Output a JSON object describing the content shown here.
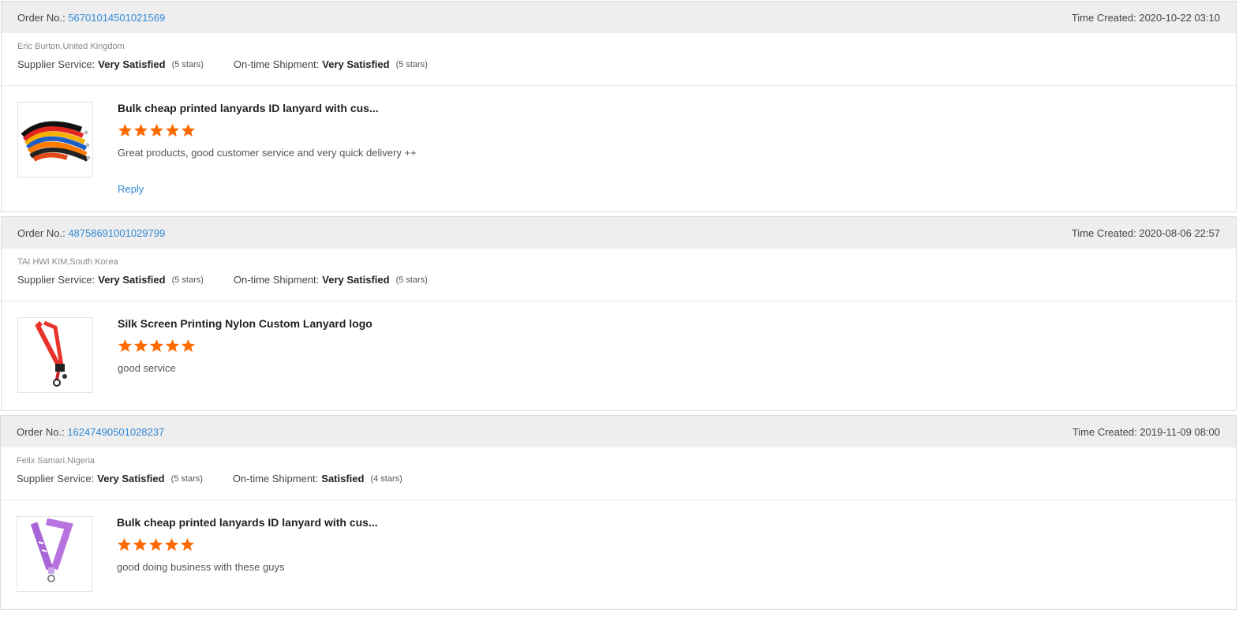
{
  "labels": {
    "order_no": "Order No.:",
    "time_created": "Time Created:",
    "supplier_service": "Supplier Service:",
    "on_time_shipment": "On-time Shipment:",
    "reply": "Reply"
  },
  "reviews": [
    {
      "order_no": "56701014501021569",
      "time_created": "2020-10-22 03:10",
      "buyer": "Eric Burton,United Kingdom",
      "supplier_service": "Very Satisfied",
      "supplier_service_stars": "(5 stars)",
      "on_time_shipment": "Very Satisfied",
      "on_time_shipment_stars": "(5 stars)",
      "product_title": "Bulk cheap printed lanyards ID lanyard with cus...",
      "rating": 5,
      "comment": "Great products, good customer service and very quick delivery ++",
      "has_reply": true,
      "thumb_icon": "multicolor-lanyards-icon"
    },
    {
      "order_no": "48758691001029799",
      "time_created": "2020-08-06 22:57",
      "buyer": "TAI HWI KIM,South Korea",
      "supplier_service": "Very Satisfied",
      "supplier_service_stars": "(5 stars)",
      "on_time_shipment": "Very Satisfied",
      "on_time_shipment_stars": "(5 stars)",
      "product_title": "Silk Screen Printing Nylon Custom Lanyard logo",
      "rating": 5,
      "comment": "good service",
      "has_reply": false,
      "thumb_icon": "red-lanyard-icon"
    },
    {
      "order_no": "16247490501028237",
      "time_created": "2019-11-09 08:00",
      "buyer": "Felix Samari,Nigeria",
      "supplier_service": "Very Satisfied",
      "supplier_service_stars": "(5 stars)",
      "on_time_shipment": "Satisfied",
      "on_time_shipment_stars": "(4 stars)",
      "product_title": "Bulk cheap printed lanyards ID lanyard with cus...",
      "rating": 5,
      "comment": "good doing business with these guys",
      "has_reply": false,
      "thumb_icon": "purple-lanyard-icon"
    }
  ],
  "colors": {
    "link": "#2f88d6",
    "star": "#ff6a00",
    "header_bg": "#eeeeee"
  }
}
